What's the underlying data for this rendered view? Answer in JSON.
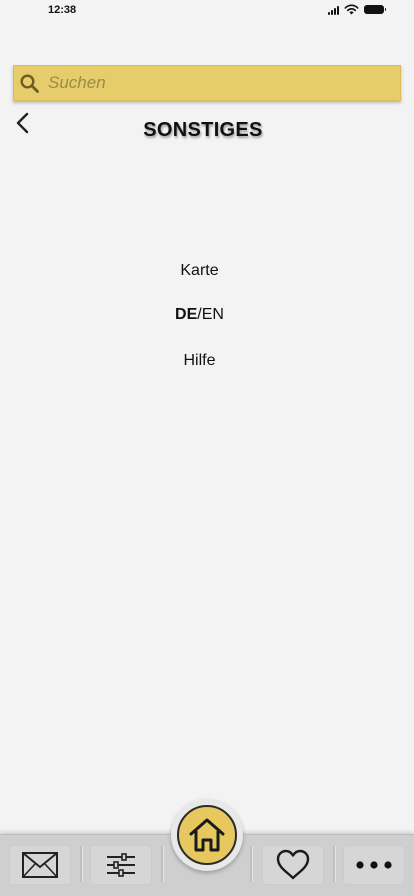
{
  "status_bar": {
    "time": "12:38",
    "icons": [
      "signal-icon",
      "wifi-icon",
      "battery-icon"
    ]
  },
  "search": {
    "placeholder": "Suchen",
    "value": "",
    "icon": "search-icon",
    "color": "#e6cc6b"
  },
  "header": {
    "back_icon": "chevron-left-icon",
    "title": "SONSTIGES"
  },
  "menu": {
    "map_label": "Karte",
    "lang_de": "DE",
    "lang_separator": "/",
    "lang_en": "EN",
    "help_label": "Hilfe"
  },
  "bottom_nav": {
    "items": [
      {
        "icon": "mail-icon"
      },
      {
        "icon": "sliders-icon"
      },
      {
        "icon": "home-icon",
        "active": true
      },
      {
        "icon": "heart-icon"
      },
      {
        "icon": "more-icon"
      }
    ],
    "active_color": "#e6c85f"
  }
}
